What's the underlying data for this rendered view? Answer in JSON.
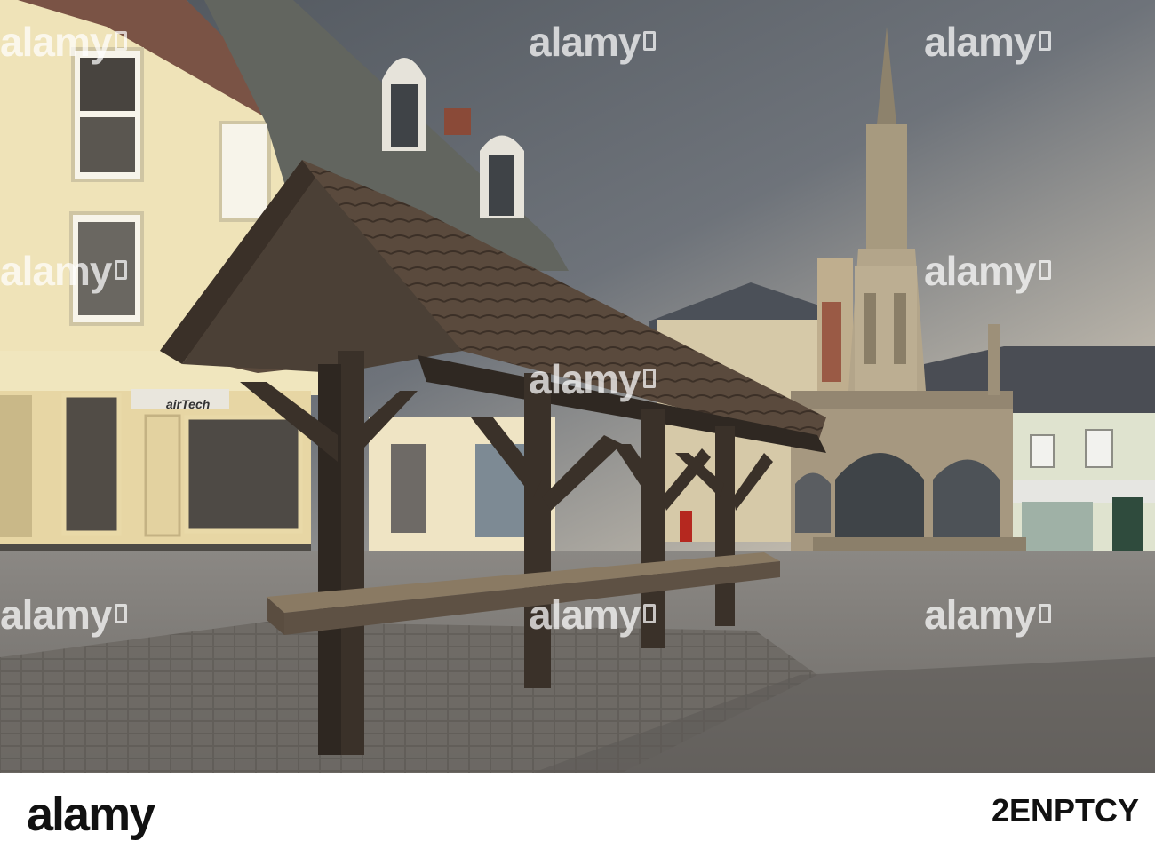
{
  "photo": {
    "signs": {
      "shop_sign": "airTech"
    },
    "watermarks": [
      "alamy",
      "alamy",
      "alamy",
      "alamy",
      "alamy",
      "alamy",
      "alamy",
      "alamy",
      "alamy"
    ]
  },
  "footer": {
    "brand": "alamy",
    "image_id": "2ENPTCY",
    "background": "#ffffff"
  },
  "colors": {
    "sky_top": "#5e646b",
    "sky_glow": "#e9ddc8",
    "building_cream": "#efe3b8",
    "stone": "#a89a7e",
    "timber": "#3e342b",
    "paving": "#7f7d79"
  }
}
